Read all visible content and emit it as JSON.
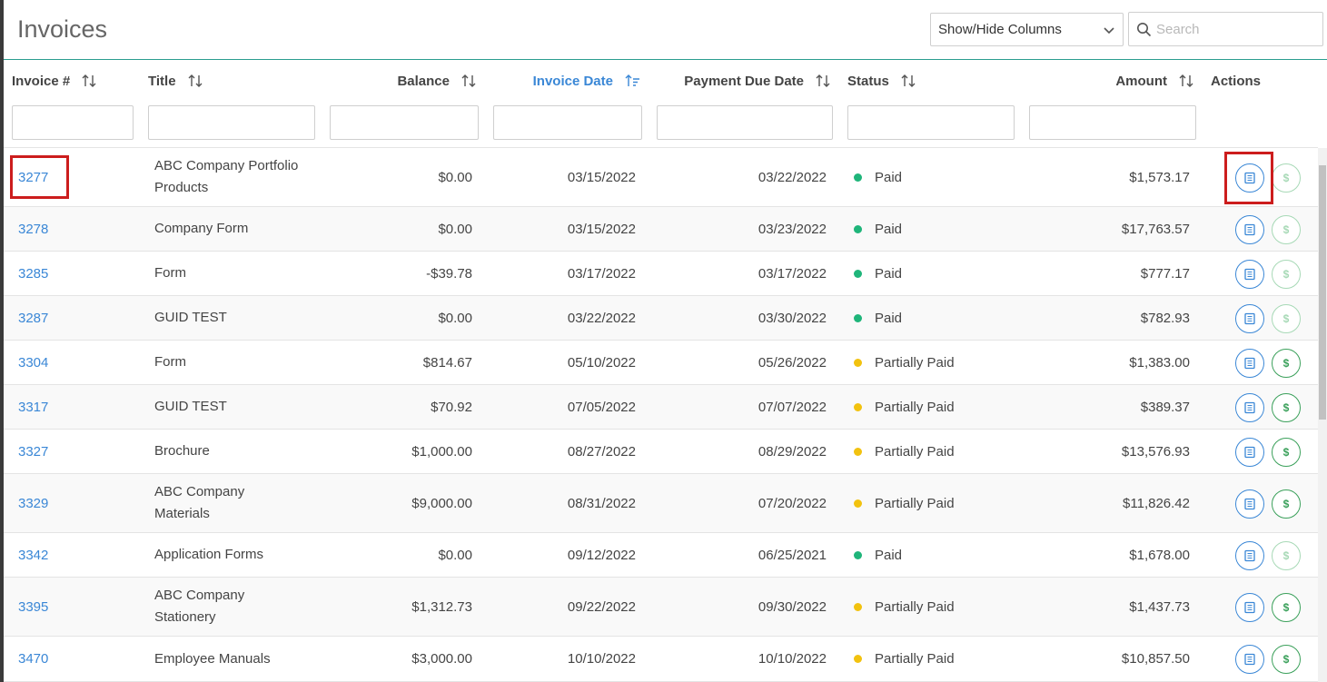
{
  "page": {
    "title": "Invoices"
  },
  "toolbar": {
    "column_select_label": "Show/Hide Columns",
    "search_placeholder": "Search"
  },
  "columns": [
    {
      "key": "invoice",
      "label": "Invoice #",
      "sort": "none"
    },
    {
      "key": "title",
      "label": "Title",
      "sort": "none"
    },
    {
      "key": "balance",
      "label": "Balance",
      "sort": "none"
    },
    {
      "key": "invoice_date",
      "label": "Invoice Date",
      "sort": "ascending"
    },
    {
      "key": "due_date",
      "label": "Payment Due Date",
      "sort": "none"
    },
    {
      "key": "status",
      "label": "Status",
      "sort": "none"
    },
    {
      "key": "amount",
      "label": "Amount",
      "sort": "none"
    },
    {
      "key": "actions",
      "label": "Actions"
    }
  ],
  "colors": {
    "link": "#3a87d6",
    "paid": "#1fb57a",
    "partially_paid": "#f2c20f",
    "view_button": "#3a87d6",
    "pay_button": "#3aa05a",
    "pay_button_disabled": "#a7d9b6",
    "highlight": "#cc1d1d"
  },
  "rows": [
    {
      "invoice": "3277",
      "title": [
        "ABC Company Portfolio",
        "Products"
      ],
      "balance": "$0.00",
      "invoice_date": "03/15/2022",
      "due_date": "03/22/2022",
      "status": "Paid",
      "amount": "$1,573.17",
      "pay_enabled": false
    },
    {
      "invoice": "3278",
      "title": [
        "Company Form"
      ],
      "balance": "$0.00",
      "invoice_date": "03/15/2022",
      "due_date": "03/23/2022",
      "status": "Paid",
      "amount": "$17,763.57",
      "pay_enabled": false
    },
    {
      "invoice": "3285",
      "title": [
        "Form"
      ],
      "balance": "-$39.78",
      "invoice_date": "03/17/2022",
      "due_date": "03/17/2022",
      "status": "Paid",
      "amount": "$777.17",
      "pay_enabled": false
    },
    {
      "invoice": "3287",
      "title": [
        "GUID TEST"
      ],
      "balance": "$0.00",
      "invoice_date": "03/22/2022",
      "due_date": "03/30/2022",
      "status": "Paid",
      "amount": "$782.93",
      "pay_enabled": false
    },
    {
      "invoice": "3304",
      "title": [
        "Form"
      ],
      "balance": "$814.67",
      "invoice_date": "05/10/2022",
      "due_date": "05/26/2022",
      "status": "Partially Paid",
      "amount": "$1,383.00",
      "pay_enabled": true
    },
    {
      "invoice": "3317",
      "title": [
        "GUID TEST"
      ],
      "balance": "$70.92",
      "invoice_date": "07/05/2022",
      "due_date": "07/07/2022",
      "status": "Partially Paid",
      "amount": "$389.37",
      "pay_enabled": true
    },
    {
      "invoice": "3327",
      "title": [
        "Brochure"
      ],
      "balance": "$1,000.00",
      "invoice_date": "08/27/2022",
      "due_date": "08/29/2022",
      "status": "Partially Paid",
      "amount": "$13,576.93",
      "pay_enabled": true
    },
    {
      "invoice": "3329",
      "title": [
        "ABC Company",
        "Materials"
      ],
      "balance": "$9,000.00",
      "invoice_date": "08/31/2022",
      "due_date": "07/20/2022",
      "status": "Partially Paid",
      "amount": "$11,826.42",
      "pay_enabled": true
    },
    {
      "invoice": "3342",
      "title": [
        "Application Forms"
      ],
      "balance": "$0.00",
      "invoice_date": "09/12/2022",
      "due_date": "06/25/2021",
      "status": "Paid",
      "amount": "$1,678.00",
      "pay_enabled": false
    },
    {
      "invoice": "3395",
      "title": [
        "ABC Company",
        "Stationery"
      ],
      "balance": "$1,312.73",
      "invoice_date": "09/22/2022",
      "due_date": "09/30/2022",
      "status": "Partially Paid",
      "amount": "$1,437.73",
      "pay_enabled": true
    },
    {
      "invoice": "3470",
      "title": [
        "Employee Manuals"
      ],
      "balance": "$3,000.00",
      "invoice_date": "10/10/2022",
      "due_date": "10/10/2022",
      "status": "Partially Paid",
      "amount": "$10,857.50",
      "pay_enabled": true
    }
  ],
  "action_icons": {
    "view": "document-icon",
    "pay": "dollar-icon",
    "pay_glyph": "$"
  },
  "highlights": [
    "invoice-3277",
    "view-button-3277"
  ]
}
